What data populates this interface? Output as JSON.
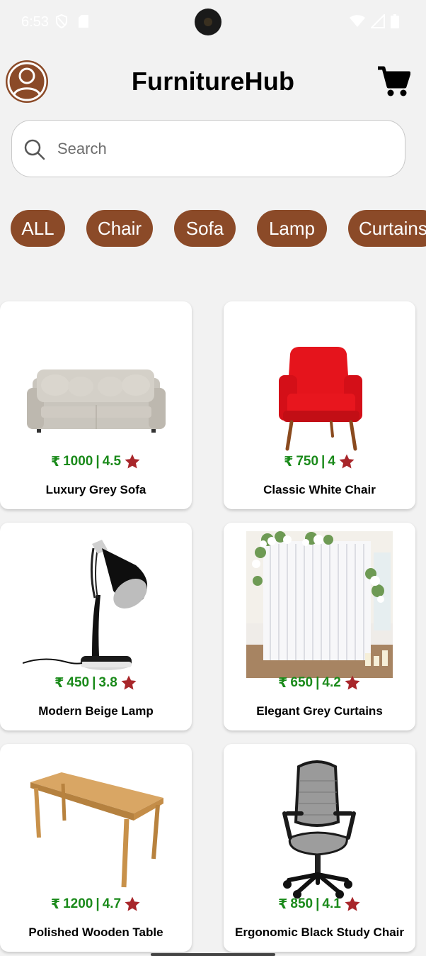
{
  "status_bar": {
    "time": "6:53"
  },
  "header": {
    "title": "FurnitureHub"
  },
  "search": {
    "placeholder": "Search"
  },
  "categories": [
    "ALL",
    "Chair",
    "Sofa",
    "Lamp",
    "Curtains"
  ],
  "currency_symbol": "₹",
  "rating_separator": "|",
  "colors": {
    "accent": "#8b4a28",
    "price": "#1a8a1a",
    "star": "#a8262a",
    "background": "#f2f2f2"
  },
  "products": [
    {
      "name": "Luxury Grey Sofa",
      "price": "1000",
      "rating": "4.5",
      "image": "sofa-image"
    },
    {
      "name": "Classic White Chair",
      "price": "750",
      "rating": "4",
      "image": "armchair-image"
    },
    {
      "name": "Modern Beige Lamp",
      "price": "450",
      "rating": "3.8",
      "image": "desk-lamp-image"
    },
    {
      "name": "Elegant Grey Curtains",
      "price": "650",
      "rating": "4.2",
      "image": "curtains-image"
    },
    {
      "name": "Polished Wooden Table",
      "price": "1200",
      "rating": "4.7",
      "image": "table-image"
    },
    {
      "name": "Ergonomic Black Study Chair",
      "price": "850",
      "rating": "4.1",
      "image": "office-chair-image"
    }
  ]
}
